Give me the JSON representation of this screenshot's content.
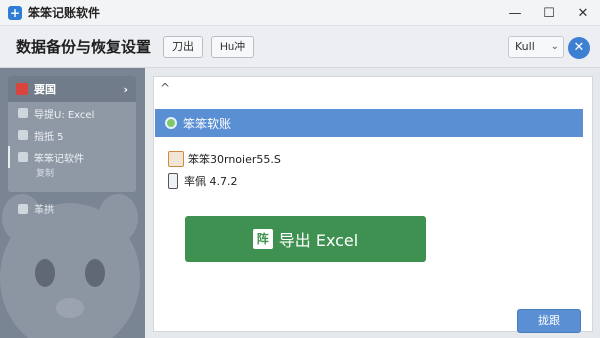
{
  "window": {
    "title": "笨笨记账软件",
    "controls": [
      "—",
      "☐",
      "✕"
    ]
  },
  "header": {
    "title": "数据备份与恢复设置",
    "buttons": [
      "刀出",
      "Hu冲"
    ],
    "user_select": "Kull",
    "close_label": "✕"
  },
  "sidebar": {
    "heading": "要国",
    "items": [
      {
        "label": "导提U: Excel"
      },
      {
        "label": "指抵 5"
      },
      {
        "label": "笨笨记软件",
        "sub": "复制"
      }
    ],
    "bottom_item": "革拱"
  },
  "main": {
    "section_title": "笨笨软账",
    "info_rows": [
      "笨笨30rnoier55.S",
      "率佩 4.7.2"
    ],
    "export_label": "导出 Excel",
    "confirm_label": "拢跟"
  }
}
